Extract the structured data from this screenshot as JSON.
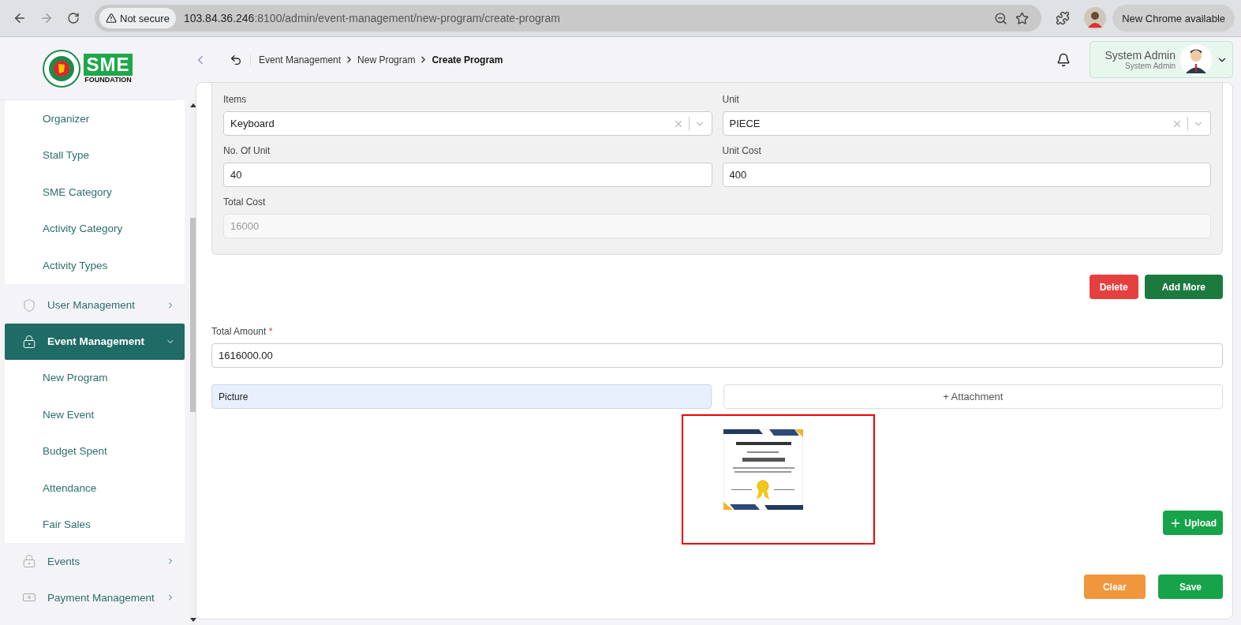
{
  "browser": {
    "security": "Not secure",
    "url_host": "103.84.36.246",
    "url_path": ":8100/admin/event-management/new-program/create-program",
    "update": "New Chrome available"
  },
  "logo": {
    "name": "SME",
    "subtitle": "FOUNDATION"
  },
  "breadcrumb": [
    {
      "label": "Event Management",
      "current": false
    },
    {
      "label": "New Program",
      "current": false
    },
    {
      "label": "Create Program",
      "current": true
    }
  ],
  "user": {
    "name": "System Admin",
    "role": "System Admin"
  },
  "sidebar": {
    "submenu_items": [
      {
        "label": "Organizer",
        "selected": false
      },
      {
        "label": "Stall Type",
        "selected": false
      },
      {
        "label": "SME Category",
        "selected": false
      },
      {
        "label": "Activity Category",
        "selected": false
      },
      {
        "label": "Activity Types",
        "selected": false
      }
    ],
    "modules": [
      {
        "kind": "user",
        "label": "User Management",
        "selected": false,
        "expanded": false
      },
      {
        "kind": "event",
        "label": "Event Management",
        "selected": true,
        "expanded": true,
        "children": [
          {
            "label": "New Program",
            "selected": false
          },
          {
            "label": "New Event",
            "selected": false
          },
          {
            "label": "Budget Spent",
            "selected": false
          },
          {
            "label": "Attendance",
            "selected": false
          },
          {
            "label": "Fair Sales",
            "selected": false
          }
        ]
      },
      {
        "kind": "event",
        "label": "Events",
        "selected": false,
        "expanded": false
      },
      {
        "kind": "payment",
        "label": "Payment Management",
        "selected": false,
        "expanded": false
      }
    ]
  },
  "cost_item": {
    "items": {
      "label": "Items",
      "value": "Keyboard"
    },
    "unit": {
      "label": "Unit",
      "value": "PIECE"
    },
    "units": {
      "label": "No. Of Unit",
      "value": "40"
    },
    "unit_cost": {
      "label": "Unit Cost",
      "value": "400"
    },
    "total_cost": {
      "label": "Total Cost",
      "value": "16000",
      "disabled": true
    }
  },
  "row_buttons": {
    "delete": "Delete",
    "add": "Add More"
  },
  "total_amount": {
    "label": "Total Amount",
    "required_mark": "*",
    "value": "1616000.00"
  },
  "attachment": {
    "name": "Picture",
    "button": "+ Attachment",
    "preview": {
      "kind": "picture",
      "highlighted": true
    },
    "upload": "Upload"
  },
  "actions": {
    "clear": "Clear",
    "save": "Save"
  }
}
